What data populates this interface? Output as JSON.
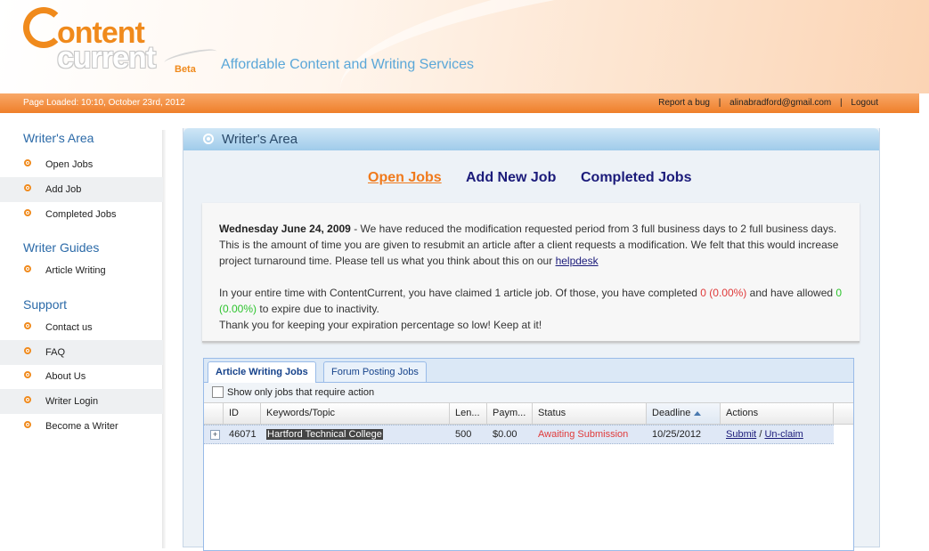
{
  "header": {
    "logo": {
      "line1": "ontent",
      "line2": "current",
      "beta": "Beta"
    },
    "tagline": "Affordable Content and Writing Services"
  },
  "topbar": {
    "page_loaded": "Page Loaded: 10:10, October 23rd, 2012",
    "report_bug": "Report a bug",
    "email": "alinabradford@gmail.com",
    "logout": "Logout",
    "separator": "|"
  },
  "sidebar": {
    "sections": [
      {
        "title": "Writer's Area",
        "items": [
          "Open Jobs",
          "Add Job",
          "Completed Jobs"
        ]
      },
      {
        "title": "Writer Guides",
        "items": [
          "Article Writing"
        ]
      },
      {
        "title": "Support",
        "items": [
          "Contact us",
          "FAQ",
          "About Us",
          "Writer Login",
          "Become a Writer"
        ]
      }
    ]
  },
  "panel": {
    "title": "Writer's Area",
    "nav": {
      "open": "Open Jobs",
      "add": "Add New Job",
      "completed": "Completed Jobs"
    }
  },
  "notice": {
    "date": "Wednesday June 24, 2009",
    "body": " - We have reduced the modification requested period from 3 full business days to 2 full business days. This is the amount of time you are given to resubmit an article after a client requests a modification. We felt that this would increase project turnaround time. Please tell us what you think about this on our ",
    "link": "helpdesk",
    "stats_a": "In your entire time with ContentCurrent, you have claimed 1 article job. Of those, you have completed ",
    "completed": "0 (0.00%)",
    "stats_b": " and have allowed ",
    "expired": "0 (0.00%)",
    "stats_c": " to expire due to inactivity.",
    "thanks": "Thank you for keeping your expiration percentage so low! Keep at it!"
  },
  "grid": {
    "tabs": [
      "Article Writing Jobs",
      "Forum Posting Jobs"
    ],
    "filter_label": "Show only jobs that require action",
    "columns": [
      "ID",
      "Keywords/Topic",
      "Len...",
      "Paym...",
      "Status",
      "Deadline",
      "Actions"
    ],
    "rows": [
      {
        "id": "46071",
        "topic": "Hartford Technical College",
        "length": "500",
        "payment": "$0.00",
        "status": "Awaiting Submission",
        "deadline": "10/25/2012",
        "action_submit": "Submit",
        "action_sep": "/",
        "action_unclaim": "Un-claim"
      }
    ]
  }
}
